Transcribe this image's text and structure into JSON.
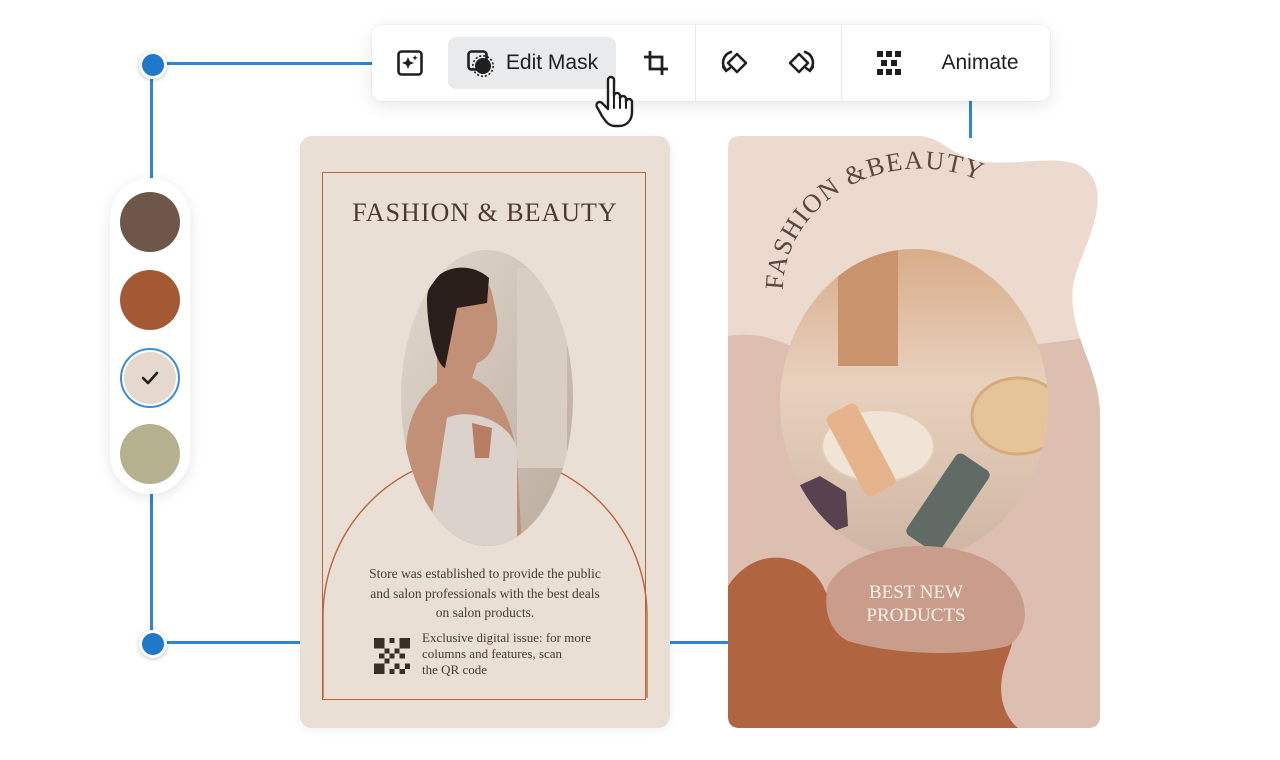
{
  "toolbar": {
    "edit_mask_label": "Edit Mask",
    "animate_label": "Animate",
    "icons": [
      "magic-enhance-icon",
      "edit-mask-icon",
      "crop-icon",
      "flip-left-icon",
      "flip-right-icon",
      "animate-icon"
    ]
  },
  "palette": {
    "swatches": [
      "#6f564a",
      "#a35a34",
      "#e5d9cf",
      "#b5b08d"
    ],
    "selected_index": 2
  },
  "left_card": {
    "title": "FASHION & BEAUTY",
    "body_line1": "Store was established to provide the public",
    "body_line2": "and salon professionals with the best deals",
    "body_line3": "on salon products.",
    "qr_line1": "Exclusive digital issue: for more",
    "qr_line2": "columns and features, scan",
    "qr_line3": "the QR code"
  },
  "right_card": {
    "title": "FASHION &BEAUTY",
    "cta_line1": "BEST NEW",
    "cta_line2": "PRODUCTS"
  },
  "colors": {
    "accent": "#2f86d1",
    "frame": "#b8653a"
  }
}
